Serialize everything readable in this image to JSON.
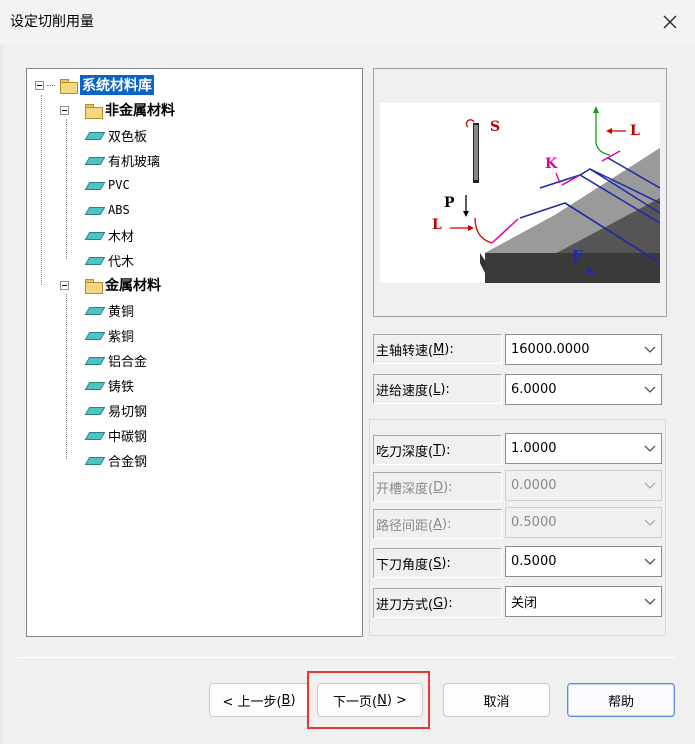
{
  "window": {
    "title": "设定切削用量",
    "close_icon": "close-icon"
  },
  "tree": {
    "root": "系统材料库",
    "groups": [
      {
        "label": "非金属材料",
        "items": [
          "双色板",
          "有机玻璃",
          "PVC",
          "ABS",
          "木材",
          "代木"
        ]
      },
      {
        "label": "金属材料",
        "items": [
          "黄铜",
          "紫铜",
          "铝合金",
          "铸铁",
          "易切钢",
          "中碳钢",
          "合金钢"
        ]
      }
    ]
  },
  "preview": {
    "labels": {
      "s": "S",
      "p": "P",
      "l_left": "L",
      "l_right": "L",
      "k": "K",
      "f": "F"
    }
  },
  "params": {
    "spindle_speed": {
      "label_pre": "主轴转速(",
      "key": "M",
      "label_post": "):",
      "value": "16000.0000"
    },
    "feed_speed": {
      "label_pre": "进给速度(",
      "key": "L",
      "label_post": "):",
      "value": "6.0000"
    },
    "cut_depth": {
      "label_pre": "吃刀深度(",
      "key": "T",
      "label_post": "):",
      "value": "1.0000"
    },
    "slot_depth": {
      "label_pre": "开槽深度(",
      "key": "D",
      "label_post": "):",
      "value": "0.0000"
    },
    "path_spacing": {
      "label_pre": "路径间距(",
      "key": "A",
      "label_post": "):",
      "value": "0.5000"
    },
    "plunge_angle": {
      "label_pre": "下刀角度(",
      "key": "S",
      "label_post": "):",
      "value": "0.5000"
    },
    "entry_mode": {
      "label_pre": "进刀方式(",
      "key": "G",
      "label_post": "):",
      "value": "关闭"
    }
  },
  "buttons": {
    "prev": {
      "pre": "< 上一步(",
      "key": "B",
      "post": ")"
    },
    "next": {
      "pre": "下一页(",
      "key": "N",
      "post": ") >"
    },
    "cancel": "取消",
    "help": "帮助"
  },
  "colors": {
    "accent": "#0a64c8",
    "highlight": "#e53935"
  }
}
